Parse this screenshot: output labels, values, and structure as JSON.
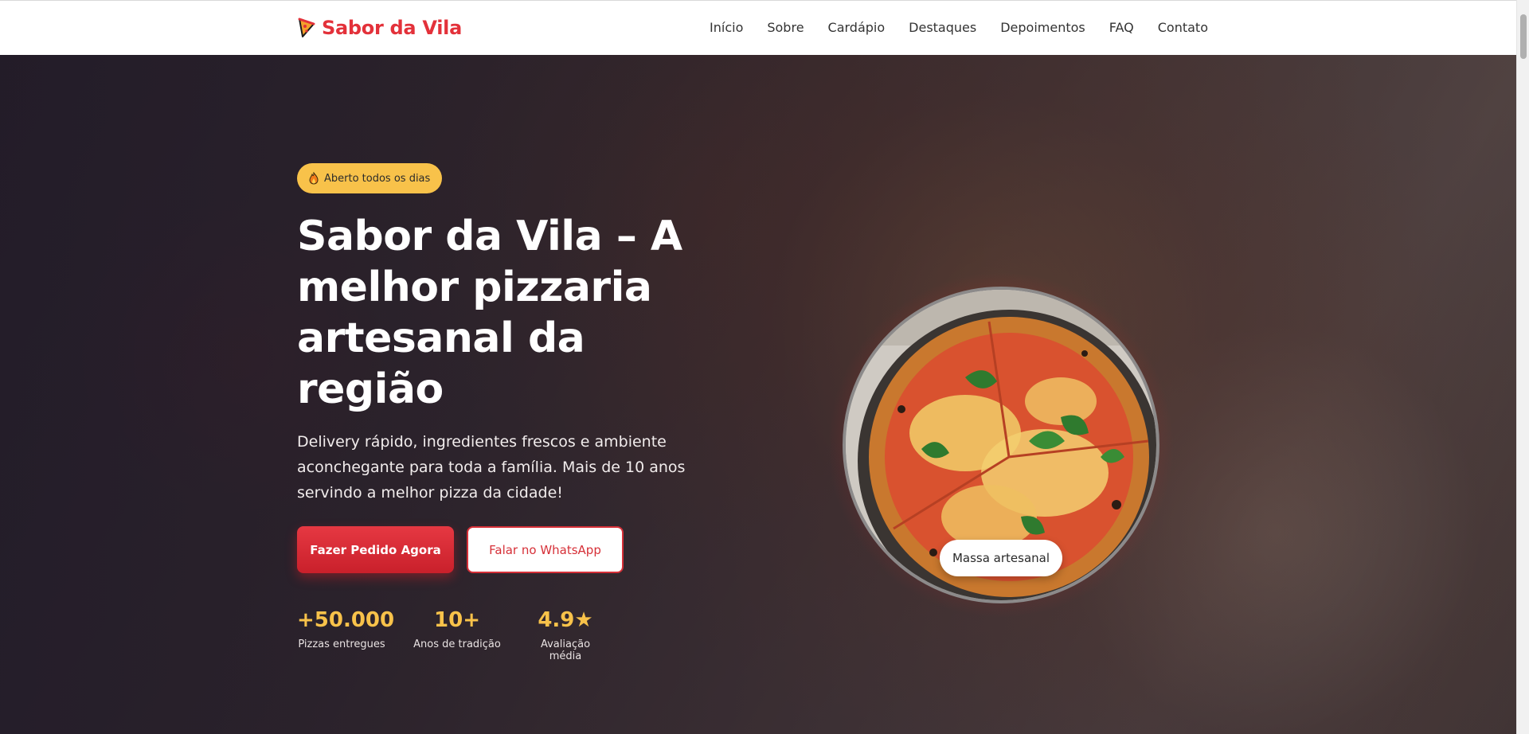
{
  "header": {
    "brand": "Sabor da Vila",
    "nav": [
      "Início",
      "Sobre",
      "Cardápio",
      "Destaques",
      "Depoimentos",
      "FAQ",
      "Contato"
    ]
  },
  "hero": {
    "badge": "Aberto todos os dias",
    "title": "Sabor da Vila – A melhor pizzaria artesanal da região",
    "subtitle": "Delivery rápido, ingredientes frescos e ambiente aconchegante para toda a família. Mais de 10 anos servindo a melhor pizza da cidade!",
    "primary_button": "Fazer Pedido Agora",
    "secondary_button": "Falar no WhatsApp",
    "stats": [
      {
        "value": "+50.000",
        "label": "Pizzas entregues"
      },
      {
        "value": "10+",
        "label": "Anos de tradição"
      },
      {
        "value": "4.9★",
        "label": "Avaliação média"
      }
    ],
    "image_chip": "Massa artesanal"
  },
  "colors": {
    "brand": "#e3313a",
    "accent": "#f8c24a",
    "primary_button": "#d8262f"
  },
  "icons": {
    "brand": "pizza-slice-icon",
    "badge": "flame-icon"
  }
}
